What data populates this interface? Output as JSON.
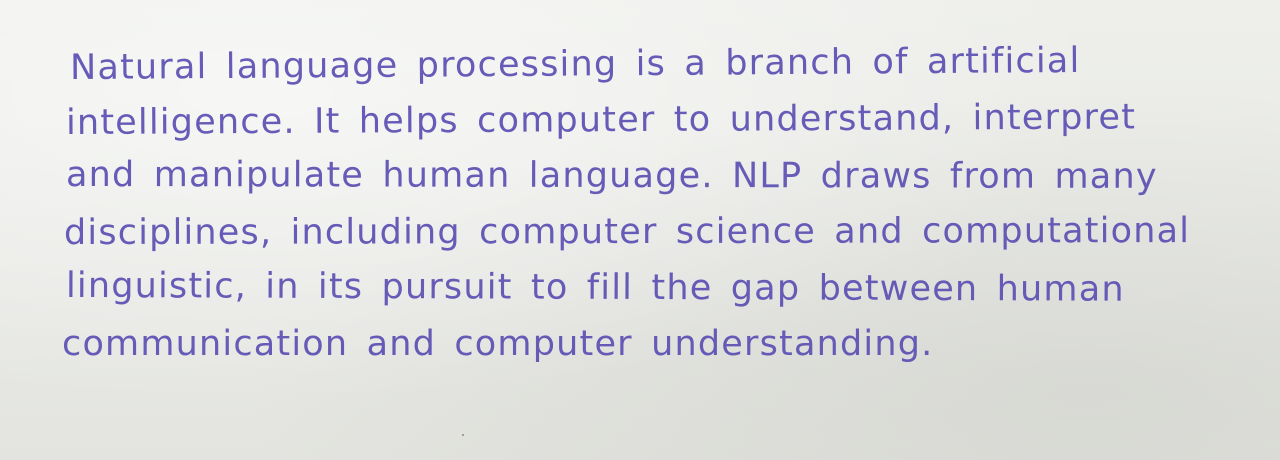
{
  "note": {
    "lines": [
      "Natural language processing is a branch of artificial",
      "intelligence. It helps computer to understand, interpret",
      "and manipulate human language. NLP draws from many",
      "disciplines, including computer science and computational",
      "linguistic, in its pursuit to fill the gap between human",
      "communication and computer understanding."
    ],
    "ink_color": "#5b4fb3",
    "paper_color": "#e9eae6"
  }
}
